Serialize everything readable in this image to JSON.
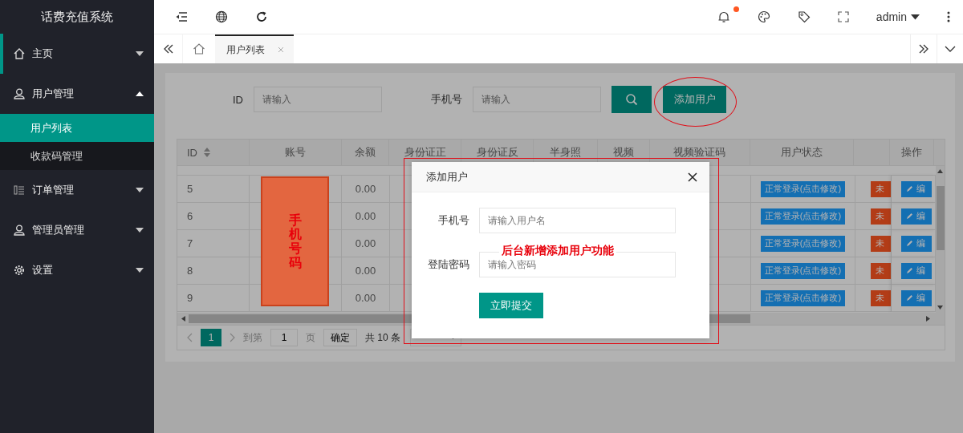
{
  "sidebar": {
    "title": "话费充值系统",
    "menu": [
      {
        "label": "主页",
        "expanded": false,
        "selected": false
      },
      {
        "label": "用户管理",
        "expanded": true,
        "selected": false,
        "children": [
          {
            "label": "用户列表",
            "selected": true
          },
          {
            "label": "收款码管理",
            "selected": false
          }
        ]
      },
      {
        "label": "订单管理",
        "expanded": false,
        "selected": false
      },
      {
        "label": "管理员管理",
        "expanded": false,
        "selected": false
      },
      {
        "label": "设置",
        "expanded": false,
        "selected": false
      }
    ]
  },
  "header": {
    "user": "admin",
    "notification_dot": true
  },
  "tabs": [
    {
      "label": "用户列表",
      "selected": true
    }
  ],
  "search": {
    "fields": [
      {
        "label": "ID",
        "placeholder": "请输入"
      },
      {
        "label": "手机号",
        "placeholder": "请输入"
      }
    ],
    "add_button": "添加用户"
  },
  "table": {
    "columns": [
      {
        "label": "ID",
        "sortable": true
      },
      {
        "label": "账号"
      },
      {
        "label": "余额"
      },
      {
        "label": "身份证正"
      },
      {
        "label": "身份证反"
      },
      {
        "label": "半身照"
      },
      {
        "label": "视频"
      },
      {
        "label": "视频验证码"
      },
      {
        "label": "用户状态"
      },
      {},
      {
        "label": "操作"
      }
    ],
    "rows": [
      {
        "id": "5",
        "balance": "0.00",
        "status": "正常登录(点击修改)",
        "column_10": "未",
        "action": "编"
      },
      {
        "id": "6",
        "balance": "0.00",
        "status": "正常登录(点击修改)",
        "column_10": "未",
        "action": "编"
      },
      {
        "id": "7",
        "balance": "0.00",
        "status": "正常登录(点击修改)",
        "column_10": "未",
        "action": "编"
      },
      {
        "id": "8",
        "balance": "0.00",
        "status": "正常登录(点击修改)",
        "column_10": "未",
        "action": "编"
      },
      {
        "id": "9",
        "balance": "0.00",
        "status": "正常登录(点击修改)",
        "column_10": "未",
        "action": "编"
      }
    ]
  },
  "pager": {
    "page": "1",
    "goto_label": "到第",
    "goto_value": "1",
    "page_unit": "页",
    "confirm": "确定",
    "total": "共 10 条"
  },
  "modal": {
    "title": "添加用户",
    "fields": [
      {
        "label": "手机号",
        "placeholder": "请输入用户名"
      },
      {
        "label": "登陆密码",
        "placeholder": "请输入密码"
      }
    ],
    "submit": "立即提交"
  },
  "annotations": {
    "block_text": "手机号码",
    "caption": "后台新增添加用户功能"
  }
}
